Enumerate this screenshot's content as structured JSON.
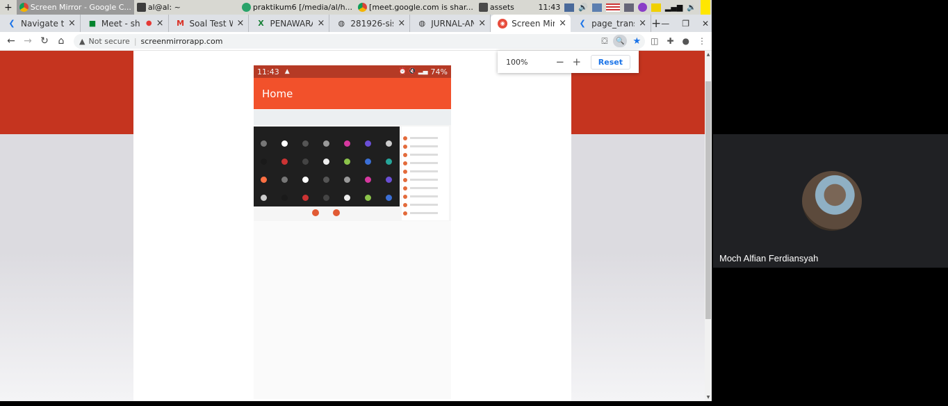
{
  "taskbar": {
    "items": [
      {
        "label": "Screen Mirror - Google C...",
        "active": true,
        "color": "#ffffff"
      },
      {
        "label": "al@al: ~",
        "active": false,
        "color": "#333333"
      },
      {
        "label": "praktikum6 [/media/al/h...",
        "active": false,
        "color": "#29a36a"
      },
      {
        "label": "[meet.google.com is shar...",
        "active": false,
        "color": "#e44134"
      },
      {
        "label": "assets",
        "active": false,
        "color": "#333333"
      }
    ],
    "clock": "11:43"
  },
  "tabs": [
    {
      "title": "Navigate to",
      "icon": "arrow-icon",
      "active": false
    },
    {
      "title": "Meet - sh",
      "icon": "meet-icon",
      "active": false
    },
    {
      "title": "Soal Test W",
      "icon": "gmail-icon",
      "active": false
    },
    {
      "title": "PENAWARA",
      "icon": "excel-icon",
      "active": false
    },
    {
      "title": "281926-sist",
      "icon": "globe-icon",
      "active": false
    },
    {
      "title": "JURNAL-AN",
      "icon": "globe-icon",
      "active": false
    },
    {
      "title": "Screen Mirr",
      "icon": "screenmirror-icon",
      "active": true
    },
    {
      "title": "page_trans",
      "icon": "arrow-icon",
      "active": false
    }
  ],
  "omnibox": {
    "security_label": "Not secure",
    "url": "screenmirrorapp.com"
  },
  "zoom_popup": {
    "level": "100%",
    "reset_label": "Reset"
  },
  "phone": {
    "status_time": "11:43",
    "status_battery": "74%",
    "app_title": "Home"
  },
  "participant": {
    "name": "Moch Alfian Ferdiansyah"
  }
}
